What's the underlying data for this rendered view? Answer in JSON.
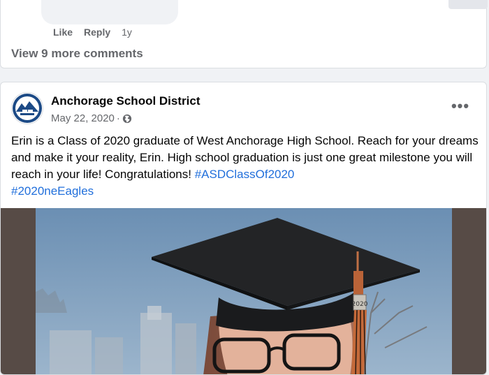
{
  "prev_post": {
    "actions": {
      "like": "Like",
      "reply": "Reply",
      "time": "1y"
    },
    "view_more": "View 9 more comments"
  },
  "post": {
    "page_name": "Anchorage School District",
    "date": "May 22, 2020",
    "separator": "·",
    "privacy_icon": "globe-icon",
    "more_icon": "more-horizontal-icon",
    "text_plain": "Erin is a Class of 2020 graduate of West Anchorage High School. Reach for your dreams and make it your reality, Erin. High school graduation is just one great milestone you will reach in your life! Congratulations! ",
    "hashtags": [
      "#ASDClassOf2020",
      "#2020neEagles"
    ],
    "photo": {
      "tassel_charm": "2020"
    }
  },
  "colors": {
    "background": "#f0f2f5",
    "card": "#ffffff",
    "secondary_text": "#65676b",
    "link": "#216fdb",
    "logo_blue": "#1c4a86"
  }
}
